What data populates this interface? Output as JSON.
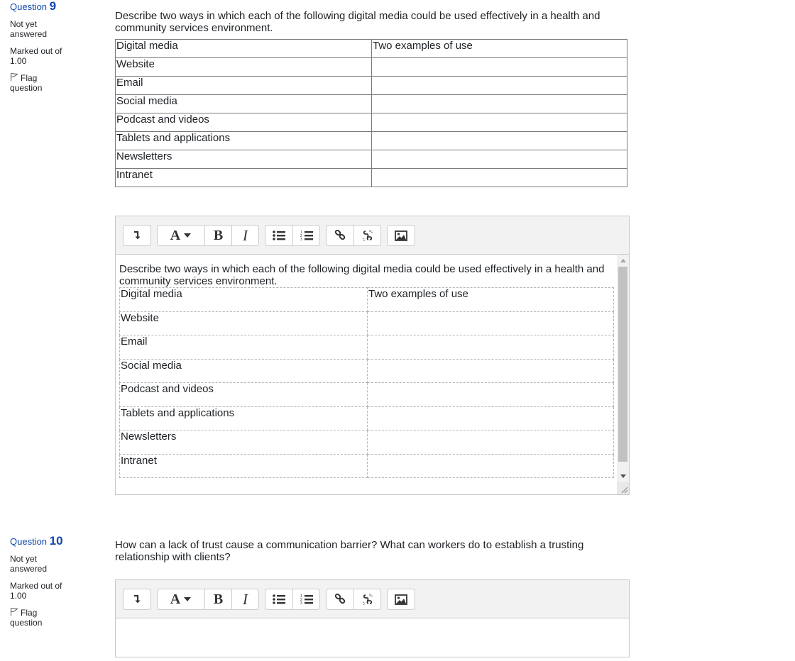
{
  "questions": [
    {
      "label": "Question",
      "number": "9",
      "state": "Not yet answered",
      "grade": "Marked out of 1.00",
      "flag_label": "Flag question",
      "text": "Describe two ways in which each of the following digital media could be used effectively in a health and community services environment.",
      "table": {
        "headers": [
          "Digital media",
          "Two examples of use"
        ],
        "rows": [
          "Website",
          "Email",
          "Social media",
          "Podcast and videos",
          "Tablets and applications",
          "Newsletters",
          "Intranet"
        ]
      },
      "editor": {
        "toolbar": [
          {
            "name": "collapse",
            "icon": "collapse-arrow-icon"
          },
          {
            "name": "font-style",
            "label": "A",
            "icon": "caret-down-icon"
          },
          {
            "name": "bold",
            "label": "B"
          },
          {
            "name": "italic",
            "label": "I"
          },
          {
            "name": "unordered-list",
            "icon": "bullet-list-icon"
          },
          {
            "name": "ordered-list",
            "icon": "numbered-list-icon"
          },
          {
            "name": "link",
            "icon": "link-icon"
          },
          {
            "name": "unlink",
            "icon": "unlink-icon"
          },
          {
            "name": "image",
            "icon": "image-icon"
          }
        ],
        "content_text": "Describe two ways in which each of the following digital media could be used effectively in a health and community services environment.",
        "content_table": {
          "headers": [
            "Digital media",
            "Two examples of use"
          ],
          "rows": [
            "Website",
            "Email",
            "Social media",
            "Podcast and videos",
            "Tablets and applications",
            "Newsletters",
            "Intranet"
          ]
        }
      }
    },
    {
      "label": "Question",
      "number": "10",
      "state": "Not yet answered",
      "grade": "Marked out of 1.00",
      "flag_label": "Flag question",
      "text": "How can a lack of trust cause a communication barrier? What can workers do to establish a trusting relationship with clients?",
      "editor": {
        "content_text": ""
      }
    }
  ],
  "colors": {
    "question_number": "#0f47ad",
    "toolbar_bg": "#f2f2f2",
    "border": "#c8c8c8"
  }
}
